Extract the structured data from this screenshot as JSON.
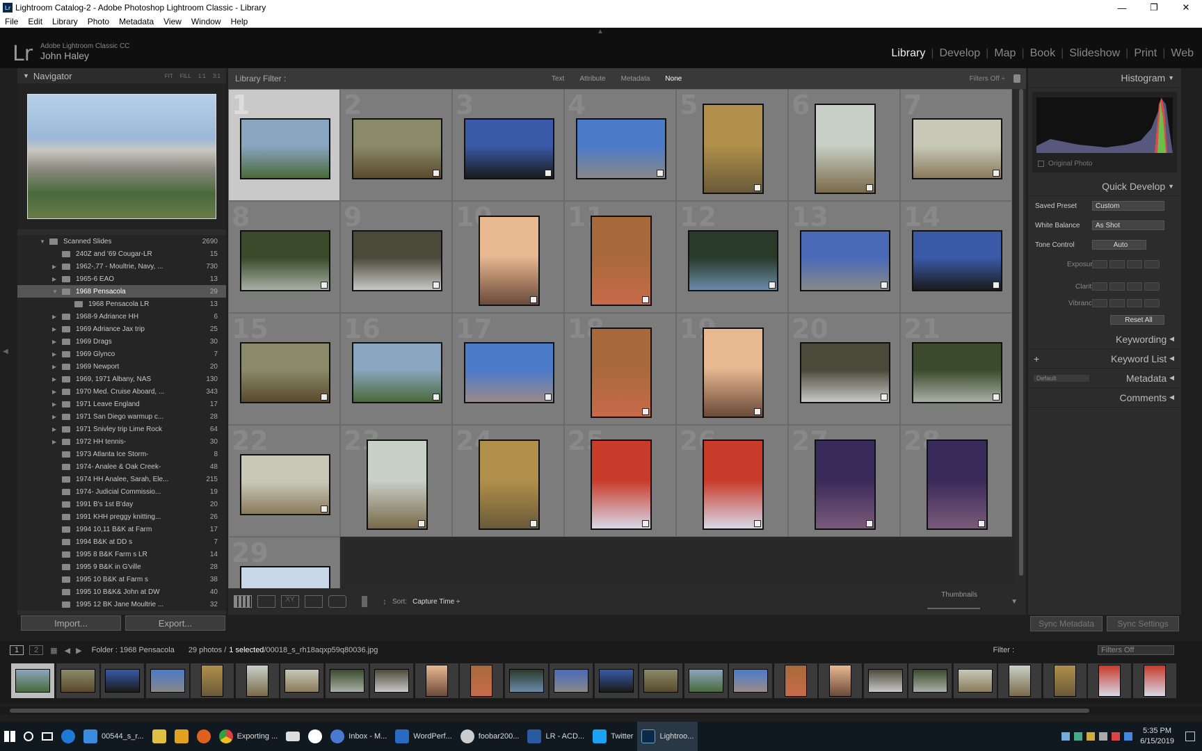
{
  "window": {
    "title": "Lightroom Catalog-2 - Adobe Photoshop Lightroom Classic - Library"
  },
  "menu": [
    "File",
    "Edit",
    "Library",
    "Photo",
    "Metadata",
    "View",
    "Window",
    "Help"
  ],
  "identity": {
    "logo": "Lr",
    "product": "Adobe Lightroom Classic CC",
    "user": "John Haley"
  },
  "modules": [
    "Library",
    "Develop",
    "Map",
    "Book",
    "Slideshow",
    "Print",
    "Web"
  ],
  "navigator": {
    "title": "Navigator",
    "options": [
      "FIT",
      "FILL",
      "1:1",
      "3:1"
    ]
  },
  "folders": [
    {
      "label": "Scanned Slides",
      "count": "2690",
      "tri": "▼",
      "indent": 0
    },
    {
      "label": "240Z and '69 Cougar-LR",
      "count": "15",
      "tri": "",
      "indent": 1
    },
    {
      "label": "1962-,77 - Moultrie, Navy, ...",
      "count": "730",
      "tri": "▶",
      "indent": 1
    },
    {
      "label": "1965-6 EAO",
      "count": "13",
      "tri": "▶",
      "indent": 1
    },
    {
      "label": "1968 Pensacola",
      "count": "29",
      "tri": "▼",
      "indent": 1,
      "selected": true
    },
    {
      "label": "1968 Pensacola LR",
      "count": "13",
      "tri": "",
      "indent": 2
    },
    {
      "label": "1968-9 Adriance HH",
      "count": "6",
      "tri": "▶",
      "indent": 1
    },
    {
      "label": "1969 Adriance Jax trip",
      "count": "25",
      "tri": "▶",
      "indent": 1
    },
    {
      "label": "1969 Drags",
      "count": "30",
      "tri": "▶",
      "indent": 1
    },
    {
      "label": "1969 Glynco",
      "count": "7",
      "tri": "▶",
      "indent": 1
    },
    {
      "label": "1969 Newport",
      "count": "20",
      "tri": "▶",
      "indent": 1
    },
    {
      "label": "1969, 1971 Albany, NAS",
      "count": "130",
      "tri": "▶",
      "indent": 1
    },
    {
      "label": "1970 Med. Cruise Aboard, ...",
      "count": "343",
      "tri": "▶",
      "indent": 1
    },
    {
      "label": "1971 Leave England",
      "count": "17",
      "tri": "▶",
      "indent": 1
    },
    {
      "label": "1971 San Diego warmup c...",
      "count": "28",
      "tri": "▶",
      "indent": 1
    },
    {
      "label": "1971 Snivley trip Lime Rock",
      "count": "64",
      "tri": "▶",
      "indent": 1
    },
    {
      "label": "1972 HH tennis-",
      "count": "30",
      "tri": "▶",
      "indent": 1
    },
    {
      "label": "1973 Atlanta Ice Storm-",
      "count": "8",
      "tri": "",
      "indent": 1
    },
    {
      "label": "1974- Analee & Oak Creek-",
      "count": "48",
      "tri": "",
      "indent": 1
    },
    {
      "label": "1974 HH Analee, Sarah, Ele...",
      "count": "215",
      "tri": "",
      "indent": 1
    },
    {
      "label": "1974- Judicial Commissio...",
      "count": "19",
      "tri": "",
      "indent": 1
    },
    {
      "label": "1991 B's 1st B'day",
      "count": "20",
      "tri": "",
      "indent": 1
    },
    {
      "label": "1991 KHH preggy knitting...",
      "count": "26",
      "tri": "",
      "indent": 1
    },
    {
      "label": "1994 10,11 B&K at Farm",
      "count": "17",
      "tri": "",
      "indent": 1
    },
    {
      "label": "1994 B&K at DD s",
      "count": "7",
      "tri": "",
      "indent": 1
    },
    {
      "label": "1995 8 B&K Farm s LR",
      "count": "14",
      "tri": "",
      "indent": 1
    },
    {
      "label": "1995 9 B&K in G'ville",
      "count": "28",
      "tri": "",
      "indent": 1
    },
    {
      "label": "1995 10 B&K at Farm s",
      "count": "38",
      "tri": "",
      "indent": 1
    },
    {
      "label": "1995 10 B&K& John at DW",
      "count": "40",
      "tri": "",
      "indent": 1
    },
    {
      "label": "1995 12 BK Jane Moultrie ...",
      "count": "32",
      "tri": "",
      "indent": 1
    }
  ],
  "buttons": {
    "import": "Import...",
    "export": "Export...",
    "sync_metadata": "Sync Metadata",
    "sync_settings": "Sync Settings"
  },
  "filter": {
    "title": "Library Filter :",
    "tabs": [
      "Text",
      "Attribute",
      "Metadata",
      "None"
    ],
    "active": "None",
    "right": "Filters Off ÷"
  },
  "grid": {
    "selected": 1,
    "photos": [
      {
        "n": "1",
        "orient": "land",
        "colors": [
          "#8aa5bf",
          "#4a6a3a"
        ]
      },
      {
        "n": "2",
        "orient": "land",
        "colors": [
          "#8a8a6a",
          "#5a4a2a"
        ]
      },
      {
        "n": "3",
        "orient": "land",
        "colors": [
          "#3a5aa8",
          "#1a1a1a"
        ]
      },
      {
        "n": "4",
        "orient": "land",
        "colors": [
          "#4a7ac8",
          "#888888"
        ]
      },
      {
        "n": "5",
        "orient": "port",
        "colors": [
          "#b0904a",
          "#6a5a3a"
        ]
      },
      {
        "n": "6",
        "orient": "port",
        "colors": [
          "#c8d0c8",
          "#7a6a4a"
        ]
      },
      {
        "n": "7",
        "orient": "land",
        "colors": [
          "#c8c8b8",
          "#8a7a5a"
        ]
      },
      {
        "n": "8",
        "orient": "land",
        "colors": [
          "#3a4a2a",
          "#a8b0a8"
        ]
      },
      {
        "n": "9",
        "orient": "land",
        "colors": [
          "#4a4a3a",
          "#c8c8c8"
        ]
      },
      {
        "n": "10",
        "orient": "port",
        "colors": [
          "#e8b890",
          "#6a4a3a"
        ]
      },
      {
        "n": "11",
        "orient": "port",
        "colors": [
          "#a86a3a",
          "#c86a4a"
        ]
      },
      {
        "n": "12",
        "orient": "land",
        "colors": [
          "#2a3a2a",
          "#6a8aa8"
        ]
      },
      {
        "n": "13",
        "orient": "land",
        "colors": [
          "#4a6ab8",
          "#888888"
        ]
      },
      {
        "n": "14",
        "orient": "land",
        "colors": [
          "#3a5aa8",
          "#1a1a1a"
        ]
      },
      {
        "n": "15",
        "orient": "land",
        "colors": [
          "#8a8a6a",
          "#5a4a2a"
        ]
      },
      {
        "n": "16",
        "orient": "land",
        "colors": [
          "#8aa5bf",
          "#4a6a3a"
        ]
      },
      {
        "n": "17",
        "orient": "land",
        "colors": [
          "#4a7ac8",
          "#9a8a8a"
        ]
      },
      {
        "n": "18",
        "orient": "port",
        "colors": [
          "#a86a3a",
          "#c86a4a"
        ]
      },
      {
        "n": "19",
        "orient": "port",
        "colors": [
          "#e8b890",
          "#6a4a3a"
        ]
      },
      {
        "n": "20",
        "orient": "land",
        "colors": [
          "#4a4a3a",
          "#c8c8c8"
        ]
      },
      {
        "n": "21",
        "orient": "land",
        "colors": [
          "#3a4a2a",
          "#a8b0a8"
        ]
      },
      {
        "n": "22",
        "orient": "land",
        "colors": [
          "#c8c8b8",
          "#8a7a5a"
        ]
      },
      {
        "n": "23",
        "orient": "port",
        "colors": [
          "#c8d0c8",
          "#7a6a4a"
        ]
      },
      {
        "n": "24",
        "orient": "port",
        "colors": [
          "#b0904a",
          "#6a5a3a"
        ]
      },
      {
        "n": "25",
        "orient": "port",
        "colors": [
          "#c83a2a",
          "#d8d8e8"
        ]
      },
      {
        "n": "26",
        "orient": "port",
        "colors": [
          "#c83a2a",
          "#d8d8e8"
        ]
      },
      {
        "n": "27",
        "orient": "port",
        "colors": [
          "#3a2a5a",
          "#7a5a7a"
        ]
      },
      {
        "n": "28",
        "orient": "port",
        "colors": [
          "#3a2a5a",
          "#7a5a7a"
        ]
      },
      {
        "n": "29",
        "orient": "land",
        "colors": [
          "#c8d8e8",
          "#c8b0a0"
        ]
      }
    ]
  },
  "toolbar": {
    "sort_label": "Sort:",
    "sort_value": "Capture Time ÷",
    "thumbnails": "Thumbnails"
  },
  "histogram": {
    "title": "Histogram",
    "original_photo": "Original Photo"
  },
  "quick_develop": {
    "title": "Quick Develop",
    "saved_preset_label": "Saved Preset",
    "saved_preset": "Custom",
    "white_balance_label": "White Balance",
    "white_balance": "As Shot",
    "tone_control_label": "Tone Control",
    "auto": "Auto",
    "exposure": "Exposure",
    "clarity": "Clarity",
    "vibrance": "Vibrance",
    "reset": "Reset All"
  },
  "right_panels": {
    "keywording": "Keywording",
    "keyword_list": "Keyword List",
    "metadata": "Metadata",
    "metadata_preset": "Default",
    "comments": "Comments"
  },
  "status": {
    "folder": "Folder : 1968 Pensacola",
    "info": "29 photos /",
    "selected": "1 selected",
    "file": "/00018_s_rh18aqxp59q80036.jpg",
    "filter_label": "Filter :",
    "filter_value": "Filters Off"
  },
  "taskbar": {
    "items": [
      "00544_s_r...",
      "Exporting ...",
      "Inbox - M...",
      "WordPerf...",
      "foobar200...",
      "LR - ACD...",
      "Twitter",
      "Lightroo..."
    ],
    "time": "5:35 PM",
    "date": "6/15/2019"
  }
}
